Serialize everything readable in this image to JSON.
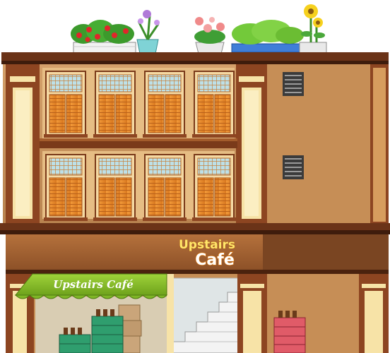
{
  "scene": {
    "title": "",
    "main_sign": {
      "line1": "Upstairs",
      "line2": "Café"
    },
    "awning_sign": "Upstairs Café",
    "colors": {
      "roof_trim": "#5a2a14",
      "wall_upper": "#c7915a",
      "wall_lower": "#a5733f",
      "pillar": "#f6e2a6",
      "pillar_dark": "#8a3f20",
      "shutter": "#e9892b",
      "window_frame": "#f5d9a3",
      "awning": "#8bbf2a",
      "stairs": "#e4e4e4"
    },
    "rooftop_plants": [
      "strawberry-planter",
      "purple-flower-pot",
      "pink-flower-pot",
      "green-shrub-planter",
      "sunflower-pot"
    ],
    "floor_items": [
      "green-crate-stack",
      "cardboard-box-stack",
      "red-crate-stack"
    ]
  }
}
